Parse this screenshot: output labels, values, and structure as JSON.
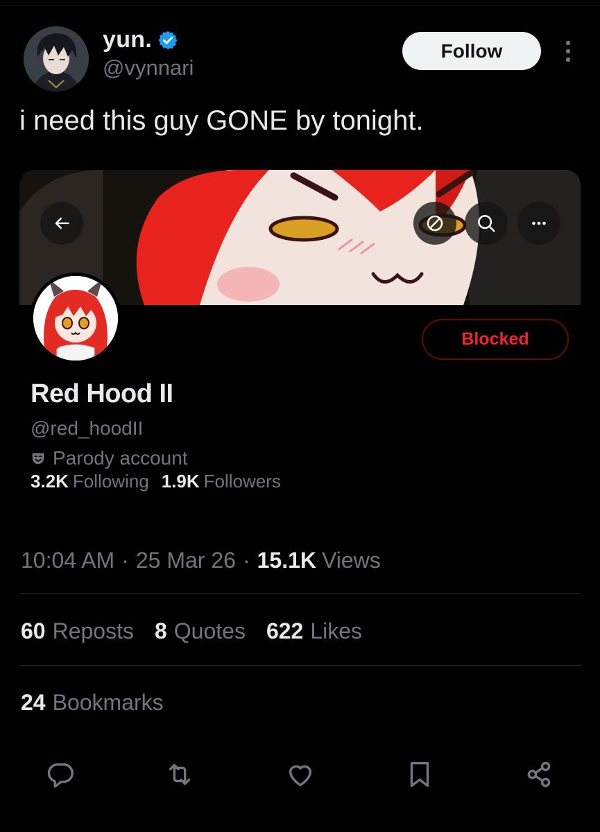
{
  "tweet": {
    "author": {
      "display_name": "yun.",
      "handle": "@vynnari",
      "verified": true
    },
    "follow_label": "Follow",
    "text": "i need this guy GONE by tonight.",
    "timestamp": {
      "time": "10:04 AM",
      "date": "25 Mar 26",
      "views_count": "15.1K",
      "views_label": "Views"
    },
    "engagement": {
      "reposts_count": "60",
      "reposts_label": "Reposts",
      "quotes_count": "8",
      "quotes_label": "Quotes",
      "likes_count": "622",
      "likes_label": "Likes",
      "bookmarks_count": "24",
      "bookmarks_label": "Bookmarks"
    }
  },
  "embedded_profile": {
    "name": "Red Hood II",
    "handle": "@red_hoodII",
    "label": "Parody account",
    "blocked_label": "Blocked",
    "following_count": "3.2K",
    "following_label": "Following",
    "followers_count": "1.9K",
    "followers_label": "Followers"
  },
  "icons": {
    "back": "arrow-left-icon",
    "unblock": "block-circle-icon",
    "search": "search-icon",
    "more": "more-horizontal-icon",
    "reply": "reply-icon",
    "repost": "repost-icon",
    "like": "heart-icon",
    "bookmark": "bookmark-icon",
    "share": "share-icon"
  },
  "colors": {
    "background": "#000000",
    "text_primary": "#e7e9ea",
    "text_secondary": "#71767b",
    "verified": "#1d9bf0",
    "blocked": "#f4212e",
    "divider": "#2f3336"
  }
}
